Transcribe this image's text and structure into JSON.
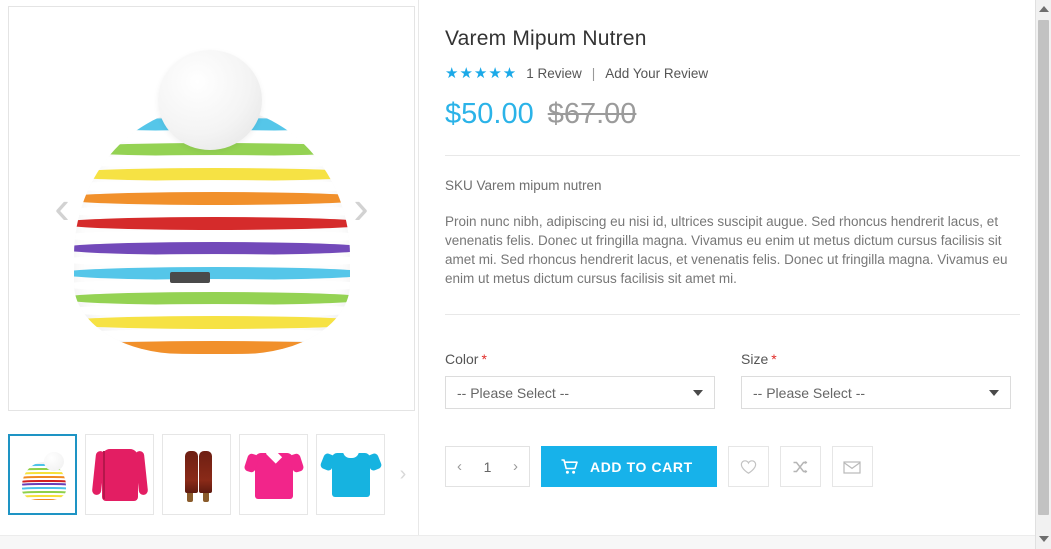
{
  "product": {
    "title": "Varem Mipum Nutren",
    "rating_stars": "★★★★★",
    "review_count": "1 Review",
    "separator": "|",
    "add_review": "Add Your Review",
    "price_special": "$50.00",
    "price_old": "$67.00",
    "sku": "SKU Varem mipum nutren",
    "description": "Proin nunc nibh, adipiscing eu nisi id, ultrices suscipit augue. Sed rhoncus hendrerit lacus, et venenatis felis. Donec ut fringilla magna. Vivamus eu enim ut metus dictum cursus facilisis sit amet mi.  Sed rhoncus hendrerit lacus, et venenatis felis. Donec ut fringilla magna. Vivamus eu enim ut metus dictum cursus facilisis sit amet mi."
  },
  "options": [
    {
      "label": "Color",
      "required": "*",
      "value": "-- Please Select --"
    },
    {
      "label": "Size",
      "required": "*",
      "value": "-- Please Select --"
    }
  ],
  "actions": {
    "qty_prev": "‹",
    "qty_value": "1",
    "qty_next": "›",
    "add_to_cart": "ADD TO CART",
    "wishlist_icon": "♡",
    "compare_icon": "⤭",
    "email_icon": "✉"
  },
  "gallery": {
    "prev_arrow": "‹",
    "next_arrow": "›",
    "thumb_next": "›",
    "thumbnails": [
      {
        "name": "knit-hat",
        "active": true
      },
      {
        "name": "pink-jacket",
        "active": false
      },
      {
        "name": "brown-boots",
        "active": false
      },
      {
        "name": "pink-polo",
        "active": false
      },
      {
        "name": "blue-tee",
        "active": false
      }
    ],
    "hat_stripe_colors": [
      "#f2f2f2",
      "#4cc3e8",
      "#ffffff",
      "#8ed04a",
      "#ffffff",
      "#f5e03a",
      "#ffffff",
      "#f08a20",
      "#ffffff",
      "#d32020",
      "#ffffff",
      "#6a3fb5",
      "#ffffff",
      "#4cc3e8",
      "#ffffff",
      "#8ed04a",
      "#ffffff",
      "#f5e03a",
      "#ffffff",
      "#f08a20"
    ]
  },
  "colors": {
    "accent": "#17b2ea",
    "price": "#2bb3e8",
    "old_price": "#9b9b9b",
    "required": "#e02b27",
    "active_thumb_border": "#1e94c4"
  },
  "scrollbar": {
    "up_arrow": "up-arrow",
    "down_arrow": "down-arrow"
  }
}
